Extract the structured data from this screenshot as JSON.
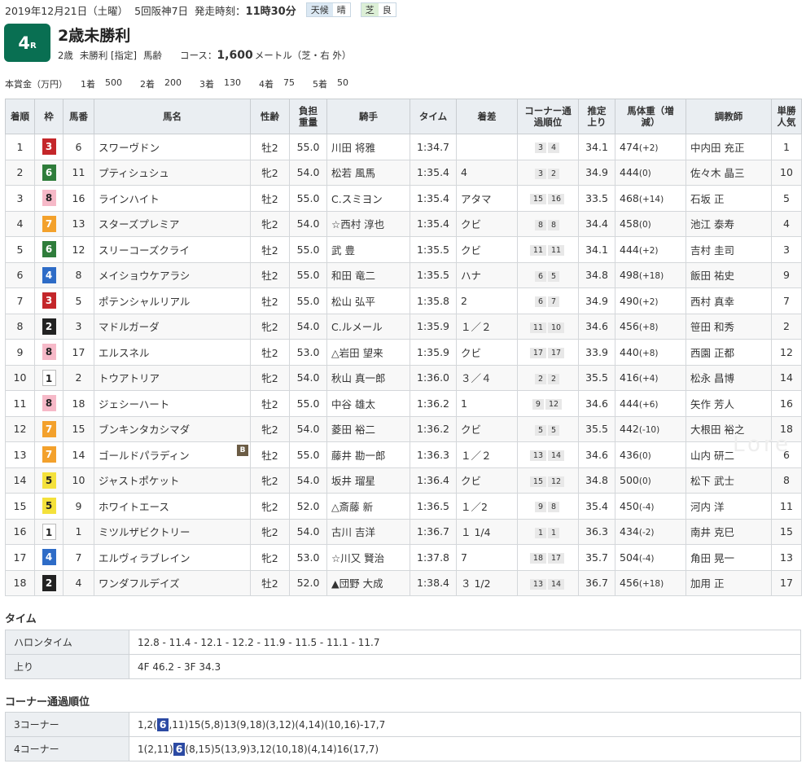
{
  "header": {
    "date": "2019年12月21日（土曜）",
    "meet": "5回阪神7日",
    "start_label": "発走時刻：",
    "start_time": "11時30分",
    "weather_label": "天候",
    "weather": "晴",
    "track_label": "芝",
    "track_cond": "良"
  },
  "race": {
    "number": "4",
    "r_suffix": "R",
    "title": "2歳未勝利",
    "info1": "2歳",
    "info2": "未勝利 [指定]",
    "info3": "馬齢",
    "course_label": "コース：",
    "distance": "1,600",
    "course_rest": "メートル（芝・右 外）"
  },
  "prize": {
    "label": "本賞金（万円）",
    "items": [
      {
        "place": "1着",
        "amount": "500"
      },
      {
        "place": "2着",
        "amount": "200"
      },
      {
        "place": "3着",
        "amount": "130"
      },
      {
        "place": "4着",
        "amount": "75"
      },
      {
        "place": "5着",
        "amount": "50"
      }
    ]
  },
  "columns": [
    "着順",
    "枠",
    "馬番",
    "馬名",
    "性齢",
    "負担重量",
    "騎手",
    "タイム",
    "着差",
    "コーナー通過順位",
    "推定上り",
    "馬体重（増減）",
    "調教師",
    "単勝人気"
  ],
  "colors": {
    "waku1": "#ffffff",
    "waku2": "#222222",
    "waku3": "#c4262a",
    "waku4": "#2e6cc7",
    "waku5": "#f4e13b",
    "waku6": "#2f7d3b",
    "waku7": "#f3a12c",
    "waku8": "#f6b9c8",
    "badge": "#096f52",
    "highlight": "#2c4aa3"
  },
  "results": [
    {
      "pos": "1",
      "waku": "3",
      "num": "6",
      "name": "スワーヴドン",
      "sex": "牡2",
      "wt": "55.0",
      "jockey": "川田 将雅",
      "time": "1:34.7",
      "margin": "",
      "c1": "3",
      "c2": "4",
      "agari": "34.1",
      "bw": "474",
      "bwd": "(+2)",
      "trainer": "中内田 充正",
      "pop": "1",
      "blinker": ""
    },
    {
      "pos": "2",
      "waku": "6",
      "num": "11",
      "name": "プティシュシュ",
      "sex": "牝2",
      "wt": "54.0",
      "jockey": "松若 風馬",
      "time": "1:35.4",
      "margin": "4",
      "c1": "3",
      "c2": "2",
      "agari": "34.9",
      "bw": "444",
      "bwd": "(0)",
      "trainer": "佐々木 晶三",
      "pop": "10",
      "blinker": ""
    },
    {
      "pos": "3",
      "waku": "8",
      "num": "16",
      "name": "ラインハイト",
      "sex": "牡2",
      "wt": "55.0",
      "jockey": "C.スミヨン",
      "time": "1:35.4",
      "margin": "アタマ",
      "c1": "15",
      "c2": "16",
      "agari": "33.5",
      "bw": "468",
      "bwd": "(+14)",
      "trainer": "石坂 正",
      "pop": "5",
      "blinker": ""
    },
    {
      "pos": "4",
      "waku": "7",
      "num": "13",
      "name": "スターズプレミア",
      "sex": "牝2",
      "wt": "54.0",
      "jockey": "☆西村 淳也",
      "time": "1:35.4",
      "margin": "クビ",
      "c1": "8",
      "c2": "8",
      "agari": "34.4",
      "bw": "458",
      "bwd": "(0)",
      "trainer": "池江 泰寿",
      "pop": "4",
      "blinker": ""
    },
    {
      "pos": "5",
      "waku": "6",
      "num": "12",
      "name": "スリーコーズクライ",
      "sex": "牡2",
      "wt": "55.0",
      "jockey": "武 豊",
      "time": "1:35.5",
      "margin": "クビ",
      "c1": "11",
      "c2": "11",
      "agari": "34.1",
      "bw": "444",
      "bwd": "(+2)",
      "trainer": "吉村 圭司",
      "pop": "3",
      "blinker": ""
    },
    {
      "pos": "6",
      "waku": "4",
      "num": "8",
      "name": "メイショウケアラシ",
      "sex": "牡2",
      "wt": "55.0",
      "jockey": "和田 竜二",
      "time": "1:35.5",
      "margin": "ハナ",
      "c1": "6",
      "c2": "5",
      "agari": "34.8",
      "bw": "498",
      "bwd": "(+18)",
      "trainer": "飯田 祐史",
      "pop": "9",
      "blinker": ""
    },
    {
      "pos": "7",
      "waku": "3",
      "num": "5",
      "name": "ポテンシャルリアル",
      "sex": "牡2",
      "wt": "55.0",
      "jockey": "松山 弘平",
      "time": "1:35.8",
      "margin": "2",
      "c1": "6",
      "c2": "7",
      "agari": "34.9",
      "bw": "490",
      "bwd": "(+2)",
      "trainer": "西村 真幸",
      "pop": "7",
      "blinker": ""
    },
    {
      "pos": "8",
      "waku": "2",
      "num": "3",
      "name": "マドルガーダ",
      "sex": "牝2",
      "wt": "54.0",
      "jockey": "C.ルメール",
      "time": "1:35.9",
      "margin": "１／２",
      "c1": "11",
      "c2": "10",
      "agari": "34.6",
      "bw": "456",
      "bwd": "(+8)",
      "trainer": "笹田 和秀",
      "pop": "2",
      "blinker": ""
    },
    {
      "pos": "9",
      "waku": "8",
      "num": "17",
      "name": "エルスネル",
      "sex": "牡2",
      "wt": "53.0",
      "jockey": "△岩田 望来",
      "time": "1:35.9",
      "margin": "クビ",
      "c1": "17",
      "c2": "17",
      "agari": "33.9",
      "bw": "440",
      "bwd": "(+8)",
      "trainer": "西園 正都",
      "pop": "12",
      "blinker": ""
    },
    {
      "pos": "10",
      "waku": "1",
      "num": "2",
      "name": "トウアトリア",
      "sex": "牝2",
      "wt": "54.0",
      "jockey": "秋山 真一郎",
      "time": "1:36.0",
      "margin": "３／４",
      "c1": "2",
      "c2": "2",
      "agari": "35.5",
      "bw": "416",
      "bwd": "(+4)",
      "trainer": "松永 昌博",
      "pop": "14",
      "blinker": ""
    },
    {
      "pos": "11",
      "waku": "8",
      "num": "18",
      "name": "ジェシーハート",
      "sex": "牡2",
      "wt": "55.0",
      "jockey": "中谷 雄太",
      "time": "1:36.2",
      "margin": "1",
      "c1": "9",
      "c2": "12",
      "agari": "34.6",
      "bw": "444",
      "bwd": "(+6)",
      "trainer": "矢作 芳人",
      "pop": "16",
      "blinker": ""
    },
    {
      "pos": "12",
      "waku": "7",
      "num": "15",
      "name": "ブンキンタカシマダ",
      "sex": "牝2",
      "wt": "54.0",
      "jockey": "菱田 裕二",
      "time": "1:36.2",
      "margin": "クビ",
      "c1": "5",
      "c2": "5",
      "agari": "35.5",
      "bw": "442",
      "bwd": "(-10)",
      "trainer": "大根田 裕之",
      "pop": "18",
      "blinker": ""
    },
    {
      "pos": "13",
      "waku": "7",
      "num": "14",
      "name": "ゴールドパラディン",
      "sex": "牡2",
      "wt": "55.0",
      "jockey": "藤井 勘一郎",
      "time": "1:36.3",
      "margin": "１／２",
      "c1": "13",
      "c2": "14",
      "agari": "34.6",
      "bw": "436",
      "bwd": "(0)",
      "trainer": "山内 研二",
      "pop": "6",
      "blinker": "B"
    },
    {
      "pos": "14",
      "waku": "5",
      "num": "10",
      "name": "ジャストポケット",
      "sex": "牝2",
      "wt": "54.0",
      "jockey": "坂井 瑠星",
      "time": "1:36.4",
      "margin": "クビ",
      "c1": "15",
      "c2": "12",
      "agari": "34.8",
      "bw": "500",
      "bwd": "(0)",
      "trainer": "松下 武士",
      "pop": "8",
      "blinker": ""
    },
    {
      "pos": "15",
      "waku": "5",
      "num": "9",
      "name": "ホワイトエース",
      "sex": "牝2",
      "wt": "52.0",
      "jockey": "△斎藤 新",
      "time": "1:36.5",
      "margin": "１／2",
      "c1": "9",
      "c2": "8",
      "agari": "35.4",
      "bw": "450",
      "bwd": "(-4)",
      "trainer": "河内 洋",
      "pop": "11",
      "blinker": ""
    },
    {
      "pos": "16",
      "waku": "1",
      "num": "1",
      "name": "ミツルザビクトリー",
      "sex": "牝2",
      "wt": "54.0",
      "jockey": "古川 吉洋",
      "time": "1:36.7",
      "margin": "１ 1/4",
      "c1": "1",
      "c2": "1",
      "agari": "36.3",
      "bw": "434",
      "bwd": "(-2)",
      "trainer": "南井 克巳",
      "pop": "15",
      "blinker": ""
    },
    {
      "pos": "17",
      "waku": "4",
      "num": "7",
      "name": "エルヴィラブレイン",
      "sex": "牝2",
      "wt": "53.0",
      "jockey": "☆川又 賢治",
      "time": "1:37.8",
      "margin": "7",
      "c1": "18",
      "c2": "17",
      "agari": "35.7",
      "bw": "504",
      "bwd": "(-4)",
      "trainer": "角田 晃一",
      "pop": "13",
      "blinker": ""
    },
    {
      "pos": "18",
      "waku": "2",
      "num": "4",
      "name": "ワンダフルデイズ",
      "sex": "牡2",
      "wt": "52.0",
      "jockey": "▲団野 大成",
      "time": "1:38.4",
      "margin": "３ 1/2",
      "c1": "13",
      "c2": "14",
      "agari": "36.7",
      "bw": "456",
      "bwd": "(+18)",
      "trainer": "加用 正",
      "pop": "17",
      "blinker": ""
    }
  ],
  "time_section": {
    "title": "タイム",
    "furlong_label": "ハロンタイム",
    "furlong": "12.8 - 11.4 - 12.1 - 12.2 - 11.9 - 11.5 - 11.1 - 11.7",
    "agari_label": "上り",
    "agari": "4F 46.2 - 3F 34.3"
  },
  "corner_section": {
    "title": "コーナー通過順位",
    "c3_label": "3コーナー",
    "c3_pre": "1,2(",
    "c3_hl": "6",
    "c3_post": ",11)15(5,8)13(9,18)(3,12)(4,14)(10,16)-17,7",
    "c4_label": "4コーナー",
    "c4_pre": "1(2,11)",
    "c4_hl": "6",
    "c4_post": "(8,15)5(13,9)3,12(10,18)(4,14)16(17,7)"
  },
  "watermark": "Lore"
}
